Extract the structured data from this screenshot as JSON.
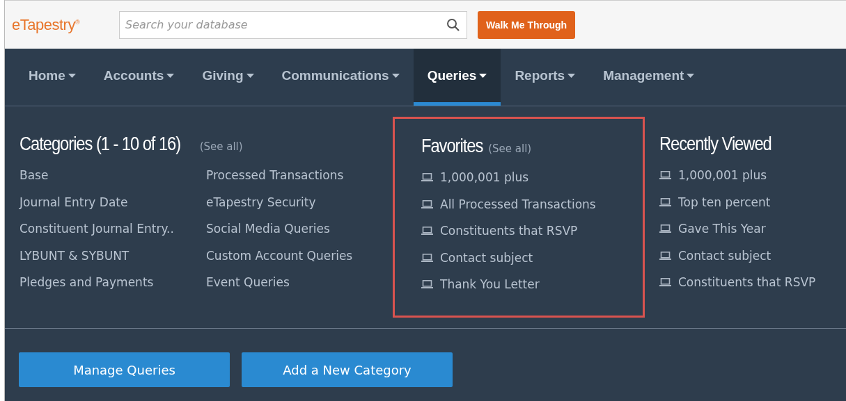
{
  "header": {
    "logo": "eTapestry",
    "logo_mark": "®",
    "search": {
      "placeholder": "Search your database"
    },
    "walk_button": "Walk Me Through"
  },
  "nav": [
    {
      "label": "Home",
      "selected": false
    },
    {
      "label": "Accounts",
      "selected": false
    },
    {
      "label": "Giving",
      "selected": false
    },
    {
      "label": "Communications",
      "selected": false
    },
    {
      "label": "Queries",
      "selected": true
    },
    {
      "label": "Reports",
      "selected": false
    },
    {
      "label": "Management",
      "selected": false
    }
  ],
  "categories": {
    "title": "Categories (1 - 10 of 16)",
    "see_all": "(See all)",
    "columns": [
      [
        "Base",
        "Journal Entry Date",
        "Constituent Journal Entry..",
        "LYBUNT & SYBUNT",
        "Pledges and Payments"
      ],
      [
        "Processed Transactions",
        "eTapestry Security",
        "Social Media Queries",
        "Custom Account Queries",
        "Event Queries"
      ]
    ]
  },
  "favorites": {
    "title": "Favorites",
    "see_all": "(See all)",
    "highlighted": true,
    "items": [
      "1,000,001 plus",
      "All Processed Transactions",
      "Constituents that RSVP",
      "Contact subject",
      "Thank You Letter"
    ]
  },
  "recently_viewed": {
    "title": "Recently Viewed",
    "items": [
      "1,000,001 plus",
      "Top ten percent",
      "Gave This Year",
      "Contact subject",
      "Constituents that RSVP"
    ]
  },
  "buttons": [
    "Manage Queries",
    "Add a New Category"
  ]
}
